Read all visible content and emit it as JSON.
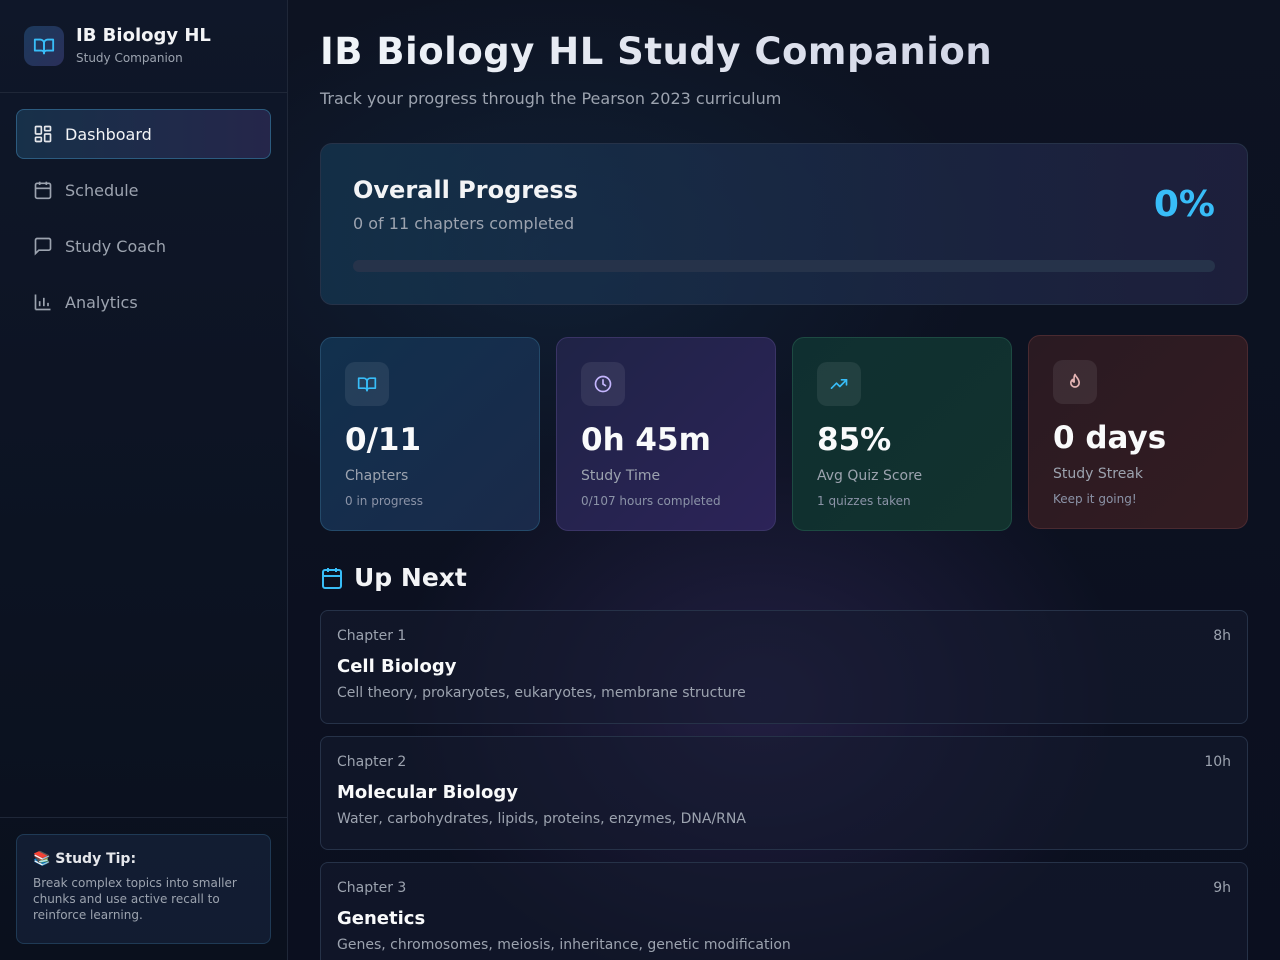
{
  "brand": {
    "title": "IB Biology HL",
    "subtitle": "Study Companion"
  },
  "nav": [
    {
      "label": "Dashboard",
      "icon": "dashboard-icon",
      "active": true
    },
    {
      "label": "Schedule",
      "icon": "calendar-icon"
    },
    {
      "label": "Study Coach",
      "icon": "chat-icon"
    },
    {
      "label": "Analytics",
      "icon": "bar-chart-icon"
    }
  ],
  "tip": {
    "title": "📚 Study Tip:",
    "text": "Break complex topics into smaller chunks and use active recall to reinforce learning."
  },
  "header": {
    "title": "IB Biology HL Study Companion",
    "subtitle": "Track your progress through the Pearson 2023 curriculum"
  },
  "progress": {
    "title": "Overall Progress",
    "subtitle": "0 of 11 chapters completed",
    "percent_label": "0%",
    "fraction": 0
  },
  "stats": [
    {
      "icon": "book-icon",
      "value": "0/11",
      "label": "Chapters",
      "note": "0 in progress"
    },
    {
      "icon": "clock-icon",
      "value": "0h 45m",
      "label": "Study Time",
      "note": "0/107 hours completed"
    },
    {
      "icon": "trend-icon",
      "value": "85%",
      "label": "Avg Quiz Score",
      "note": "1 quizzes taken"
    },
    {
      "icon": "flame-icon",
      "value": "0 days",
      "label": "Study Streak",
      "note": "Keep it going!"
    }
  ],
  "up_next": {
    "title": "Up Next",
    "chapters": [
      {
        "number": "Chapter 1",
        "hours": "8h",
        "name": "Cell Biology",
        "desc": "Cell theory, prokaryotes, eukaryotes, membrane structure"
      },
      {
        "number": "Chapter 2",
        "hours": "10h",
        "name": "Molecular Biology",
        "desc": "Water, carbohydrates, lipids, proteins, enzymes, DNA/RNA"
      },
      {
        "number": "Chapter 3",
        "hours": "9h",
        "name": "Genetics",
        "desc": "Genes, chromosomes, meiosis, inheritance, genetic modification"
      }
    ]
  },
  "colors": {
    "accent": "#38bdf8",
    "background": "#0b1020"
  }
}
